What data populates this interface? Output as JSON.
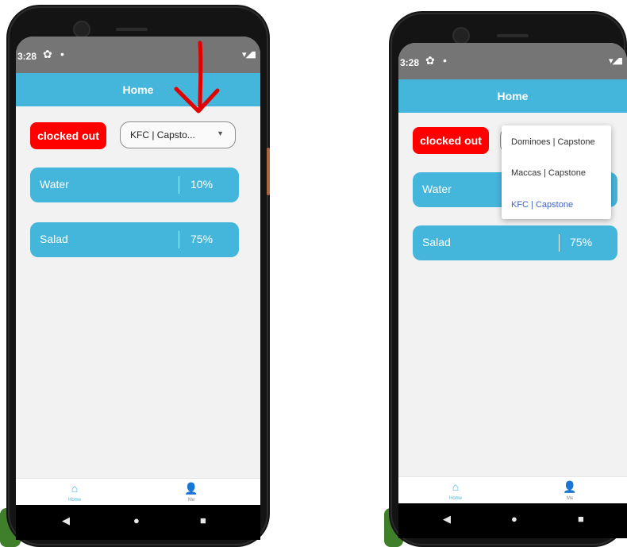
{
  "status_bar": {
    "time": "3:28",
    "gear_glyph": "✿",
    "dot_glyph": "•",
    "signal_glyph": "▾◢▮"
  },
  "app_bar": {
    "title": "Home"
  },
  "clock_button": {
    "label": "clocked out"
  },
  "left_screen": {
    "dropdown_value": "KFC | Capsto..."
  },
  "tasks": [
    {
      "name": "Water",
      "percent": "10%"
    },
    {
      "name": "Salad",
      "percent": "75%"
    }
  ],
  "dropdown_menu": {
    "options": [
      "Dominoes | Capstone",
      "Maccas | Capstone",
      "KFC | Capstone"
    ],
    "selected": "KFC | Capstone"
  },
  "bottom_nav": {
    "home": {
      "label": "Home",
      "icon": "home-icon"
    },
    "me": {
      "label": "Me",
      "icon": "person-icon"
    }
  },
  "system_nav": {
    "back": "◀",
    "home": "●",
    "recents": "■"
  },
  "glyphs": {
    "caret": "▼",
    "home": "⌂",
    "person": "👤"
  },
  "colors": {
    "accent": "#45b6db",
    "clocked_out": "#ff0000",
    "status_bar": "#757575",
    "selected_option": "#3f63c8",
    "annotation_arrow": "#e00000"
  }
}
